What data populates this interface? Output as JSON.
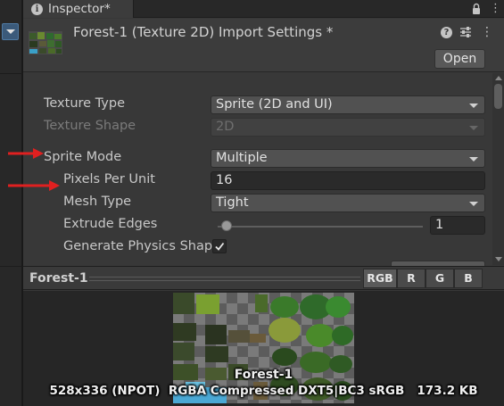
{
  "inspector_tab": {
    "label": "Inspector*"
  },
  "header": {
    "title": "Forest-1 (Texture 2D) Import Settings *",
    "open_label": "Open"
  },
  "settings": {
    "texture_type": {
      "label": "Texture Type",
      "value": "Sprite (2D and UI)"
    },
    "texture_shape": {
      "label": "Texture Shape",
      "value": "2D",
      "enabled": false
    },
    "sprite_mode": {
      "label": "Sprite Mode",
      "value": "Multiple"
    },
    "pixels_per_unit": {
      "label": "Pixels Per Unit",
      "value": "16"
    },
    "mesh_type": {
      "label": "Mesh Type",
      "value": "Tight"
    },
    "extrude_edges": {
      "label": "Extrude Edges",
      "value": "1",
      "slider_fraction": 0.03
    },
    "generate_physics_shape": {
      "label": "Generate Physics Shap",
      "checked": true
    }
  },
  "annotations": {
    "arrow_color": "#e02020",
    "arrows_point_to": [
      "sprite-mode-label",
      "pixels-per-unit-label"
    ]
  },
  "preview": {
    "title": "Forest-1",
    "channels": [
      "RGB",
      "R",
      "G",
      "B"
    ],
    "active_channel": "RGB",
    "texture_name": "Forest-1",
    "texture_info": "528x336 (NPOT)  RGBA Compressed DXT5|BC3 sRGB   173.2 KB"
  },
  "icons": {
    "tab": "info-icon",
    "lock": "lock-icon",
    "menu": "kebab-menu-icon",
    "help": "help-icon",
    "presets": "presets-icon"
  }
}
